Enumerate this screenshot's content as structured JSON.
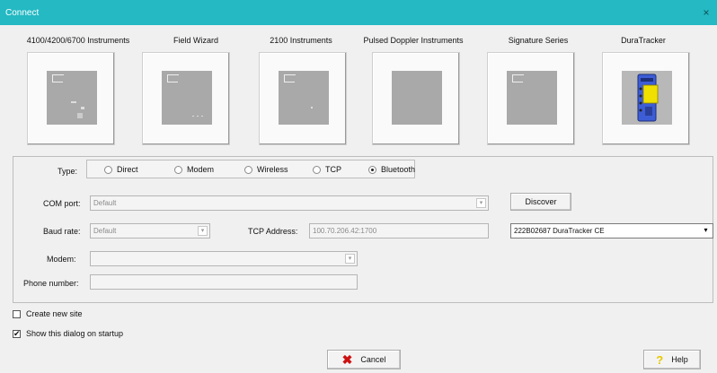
{
  "window": {
    "title": "Connect",
    "close_glyph": "×"
  },
  "instruments": [
    {
      "label": "4100/4200/6700 Instruments",
      "icon": "instrument-4100-icon"
    },
    {
      "label": "Field Wizard",
      "icon": "field-wizard-icon"
    },
    {
      "label": "2100 Instruments",
      "icon": "instrument-2100-icon"
    },
    {
      "label": "Pulsed Doppler Instruments",
      "icon": "pulsed-doppler-icon"
    },
    {
      "label": "Signature Series",
      "icon": "signature-series-icon"
    },
    {
      "label": "DuraTracker",
      "icon": "duratracker-icon"
    }
  ],
  "type": {
    "label": "Type:",
    "options": [
      "Direct",
      "Modem",
      "Wireless",
      "TCP",
      "Bluetooth"
    ],
    "selected": "Bluetooth"
  },
  "com_port": {
    "label": "COM port:",
    "value": "Default"
  },
  "discover_label": "Discover",
  "baud_rate": {
    "label": "Baud rate:",
    "value": "Default"
  },
  "tcp_address": {
    "label": "TCP Address:",
    "value": "100.70.206.42:1700"
  },
  "bluetooth_device": {
    "value": "222B02687 DuraTracker CE"
  },
  "modem": {
    "label": "Modem:",
    "value": ""
  },
  "phone_number": {
    "label": "Phone number:",
    "value": ""
  },
  "create_new_site": {
    "label": "Create new site",
    "checked": false
  },
  "show_dialog": {
    "label": "Show this dialog on startup",
    "checked": true
  },
  "cancel_label": "Cancel",
  "help_label": "Help",
  "colors": {
    "titlebar": "#24b9c3",
    "cancel_x": "#cc1111",
    "help_q": "#e8c800",
    "device_blue": "#3d5dd6",
    "device_yellow": "#f0e000"
  }
}
